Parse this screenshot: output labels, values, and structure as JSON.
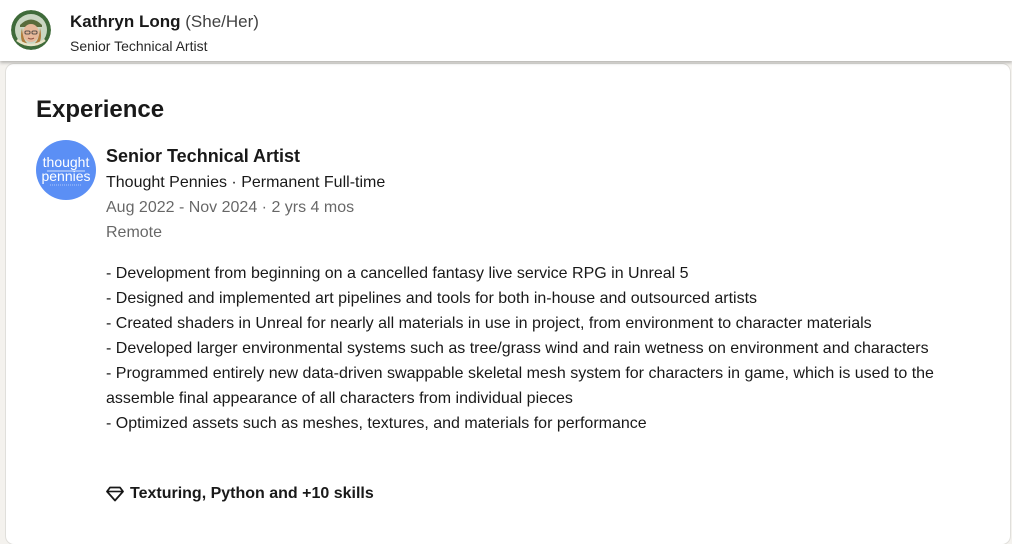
{
  "profile": {
    "name": "Kathryn Long",
    "pronouns": "(She/Her)",
    "headline": "Senior Technical Artist"
  },
  "section": {
    "title": "Experience"
  },
  "experience": {
    "logo_text_line1": "thought",
    "logo_text_line2": "pennies",
    "role_title": "Senior Technical Artist",
    "company_line": "Thought Pennies · Permanent Full-time",
    "dates": "Aug 2022 - Nov 2024 · 2 yrs 4 mos",
    "location": "Remote",
    "description": [
      "- Development from beginning on a cancelled fantasy live service RPG in Unreal 5",
      "- Designed and implemented art pipelines and tools for both in-house and outsourced artists",
      "- Created shaders in Unreal for nearly all materials in use in project, from environment to character materials",
      "- Developed larger environmental systems such as tree/grass wind and rain wetness on environment and characters",
      "- Programmed entirely new data-driven swappable skeletal mesh system for characters in game, which is used to the assemble final appearance of all characters from individual pieces",
      "- Optimized assets such as meshes, textures, and materials for performance"
    ],
    "skills_label": "Texturing, Python and +10 skills",
    "skills_icon": "diamond-icon"
  },
  "colors": {
    "logo_blue": "#5b8ff5",
    "page_bg": "#f4f2ee",
    "card_bg": "#ffffff"
  }
}
